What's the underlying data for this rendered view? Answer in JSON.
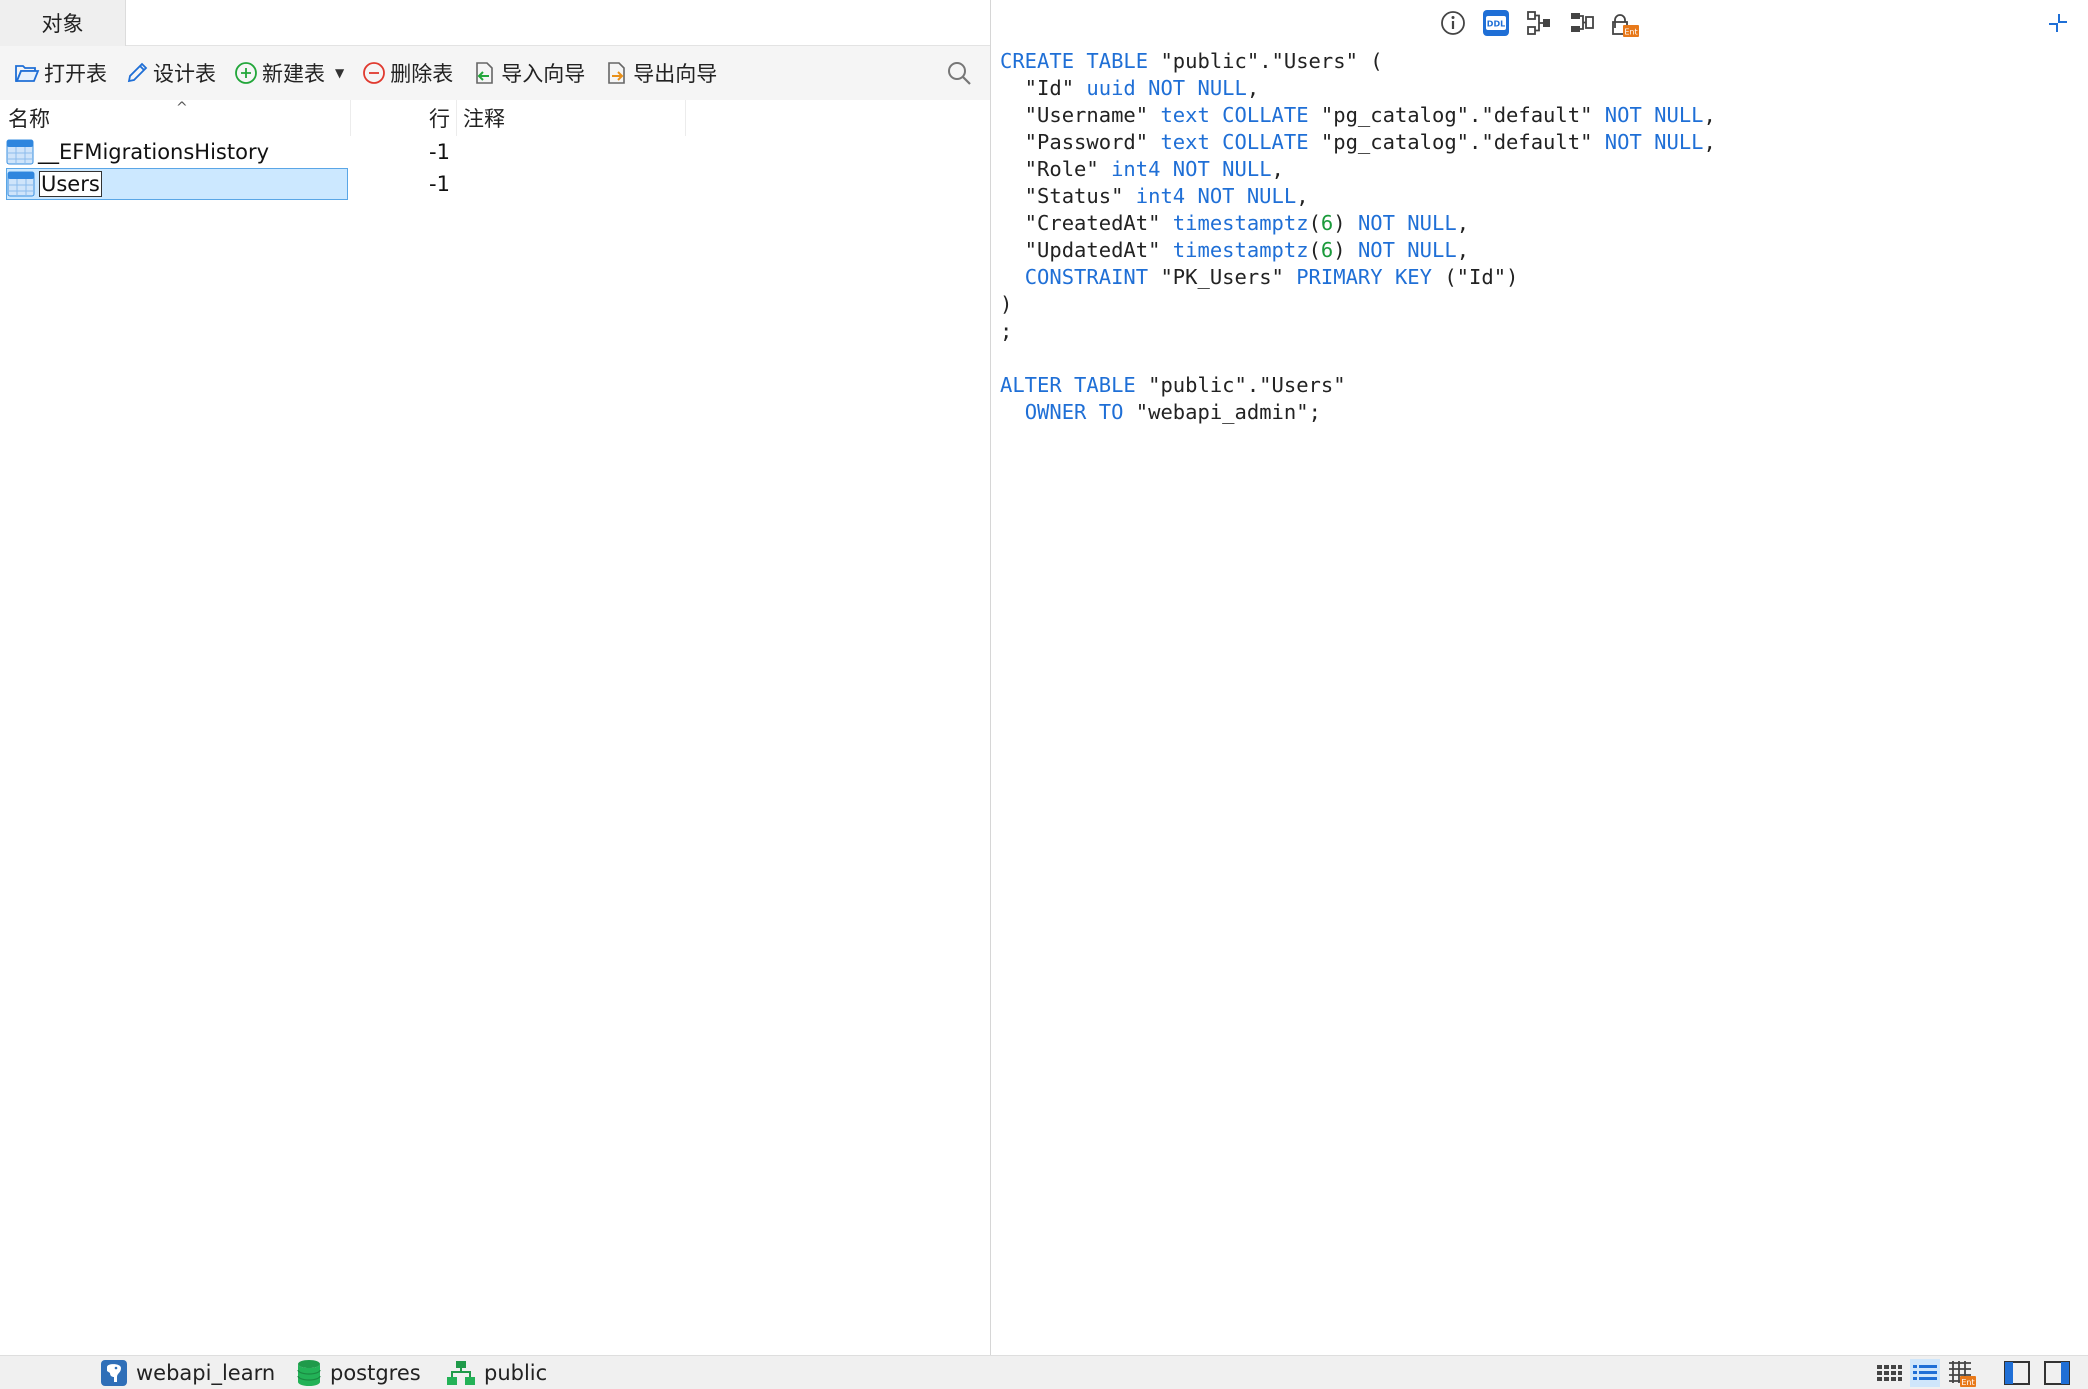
{
  "tabs": [
    {
      "label": "对象"
    }
  ],
  "toolbar": {
    "open_table": "打开表",
    "design_table": "设计表",
    "new_table": "新建表",
    "delete_table": "删除表",
    "import_wizard": "导入向导",
    "export_wizard": "导出向导"
  },
  "columns": {
    "name": "名称",
    "rows": "行",
    "comment": "注释"
  },
  "tables": [
    {
      "name": "__EFMigrationsHistory",
      "rows": "-1",
      "comment": "",
      "selected": false
    },
    {
      "name": "Users",
      "rows": "-1",
      "comment": "",
      "selected": true
    }
  ],
  "right_toolbar": {
    "icons": [
      "info-icon",
      "ddl-icon",
      "dependencies-icon",
      "relations-icon",
      "permissions-icon"
    ],
    "ddl_label": "DDL",
    "permissions_badge": "Ent",
    "active": "ddl-icon"
  },
  "ddl": {
    "lines": [
      [
        {
          "t": "CREATE TABLE",
          "c": "kw"
        },
        {
          "t": " \"public\".\"Users\" ("
        }
      ],
      [
        {
          "t": "  \"Id\" "
        },
        {
          "t": "uuid NOT NULL",
          "c": "kw"
        },
        {
          "t": ","
        }
      ],
      [
        {
          "t": "  \"Username\" "
        },
        {
          "t": "text COLLATE",
          "c": "kw"
        },
        {
          "t": " \"pg_catalog\".\"default\" "
        },
        {
          "t": "NOT NULL",
          "c": "kw"
        },
        {
          "t": ","
        }
      ],
      [
        {
          "t": "  \"Password\" "
        },
        {
          "t": "text COLLATE",
          "c": "kw"
        },
        {
          "t": " \"pg_catalog\".\"default\" "
        },
        {
          "t": "NOT NULL",
          "c": "kw"
        },
        {
          "t": ","
        }
      ],
      [
        {
          "t": "  \"Role\" "
        },
        {
          "t": "int4 NOT NULL",
          "c": "kw"
        },
        {
          "t": ","
        }
      ],
      [
        {
          "t": "  \"Status\" "
        },
        {
          "t": "int4 NOT NULL",
          "c": "kw"
        },
        {
          "t": ","
        }
      ],
      [
        {
          "t": "  \"CreatedAt\" "
        },
        {
          "t": "timestamptz",
          "c": "kw"
        },
        {
          "t": "("
        },
        {
          "t": "6",
          "c": "num"
        },
        {
          "t": ") "
        },
        {
          "t": "NOT NULL",
          "c": "kw"
        },
        {
          "t": ","
        }
      ],
      [
        {
          "t": "  \"UpdatedAt\" "
        },
        {
          "t": "timestamptz",
          "c": "kw"
        },
        {
          "t": "("
        },
        {
          "t": "6",
          "c": "num"
        },
        {
          "t": ") "
        },
        {
          "t": "NOT NULL",
          "c": "kw"
        },
        {
          "t": ","
        }
      ],
      [
        {
          "t": "  "
        },
        {
          "t": "CONSTRAINT",
          "c": "kw"
        },
        {
          "t": " \"PK_Users\" "
        },
        {
          "t": "PRIMARY KEY",
          "c": "kw"
        },
        {
          "t": " (\"Id\")"
        }
      ],
      [
        {
          "t": ")"
        }
      ],
      [
        {
          "t": ";"
        }
      ],
      [
        {
          "t": ""
        }
      ],
      [
        {
          "t": "ALTER TABLE",
          "c": "kw"
        },
        {
          "t": " \"public\".\"Users\""
        }
      ],
      [
        {
          "t": "  "
        },
        {
          "t": "OWNER TO",
          "c": "kw"
        },
        {
          "t": " \"webapi_admin\";"
        }
      ]
    ]
  },
  "status_bar": {
    "connection": "webapi_learn",
    "database": "postgres",
    "schema": "public",
    "grid_view_badge": "Ent"
  },
  "colors": {
    "keyword": "#1f6fd6",
    "number": "#1a9a3a",
    "selection": "#cce8ff"
  }
}
